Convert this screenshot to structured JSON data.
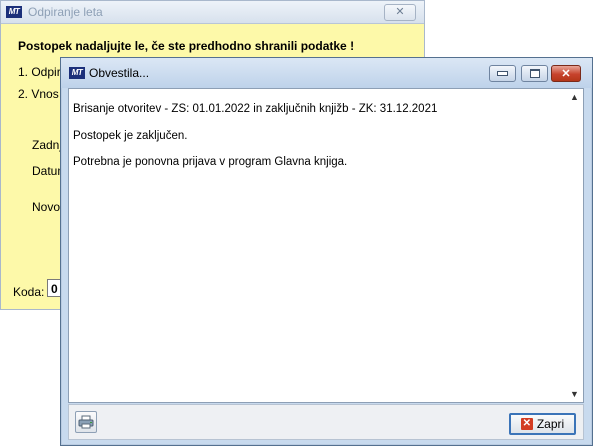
{
  "background_window": {
    "title": "Odpiranje leta",
    "close_glyph": "✕",
    "heading": "Postopek nadaljujte le, če ste predhodno shranili podatke !",
    "step1": "1. Odpira",
    "step2": "2. Vnos b",
    "label_zadnj": "Zadnj",
    "label_datum": "Datum",
    "label_novo": "Novo",
    "koda_label": "Koda:",
    "koda_value": "0"
  },
  "app_logo": "MT",
  "dialog": {
    "title": "Obvestila...",
    "messages": [
      "Brisanje otvoritev - ZS: 01.01.2022 in zaključnih knjižb - ZK: 31.12.2021",
      "Postopek je zaključen.",
      "Potrebna je ponovna prijava v program Glavna knjiga."
    ],
    "close_button_label": "Zapri",
    "close_glyph": "✕",
    "scroll_up": "▲",
    "scroll_down": "▼"
  },
  "colors": {
    "bg_window_fill": "#fdf9a9",
    "title_close_red": "#c7432c",
    "accent_blue": "#3b74b8"
  }
}
